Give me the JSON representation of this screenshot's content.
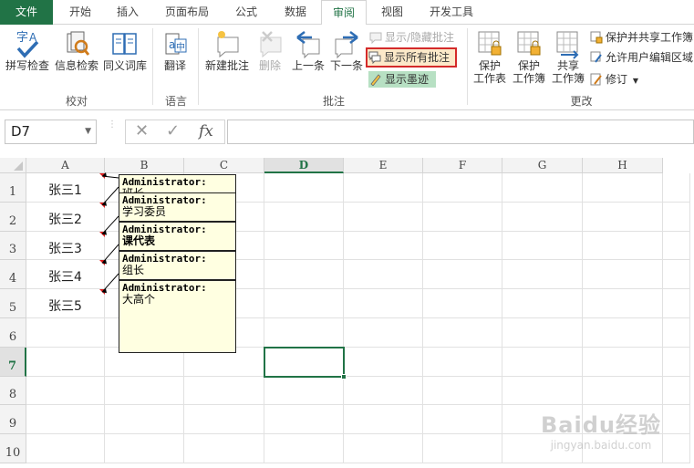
{
  "tabs": [
    "文件",
    "开始",
    "插入",
    "页面布局",
    "公式",
    "数据",
    "审阅",
    "视图",
    "开发工具"
  ],
  "active_tab": "审阅",
  "ribbon": {
    "proofing": {
      "spell": "拼写检查",
      "research": "信息检索",
      "thesaurus": "同义词库",
      "group": "校对"
    },
    "language": {
      "translate": "翻译",
      "group": "语言"
    },
    "comments": {
      "new": "新建批注",
      "delete": "删除",
      "prev": "上一条",
      "next": "下一条",
      "show_hide": "显示/隐藏批注",
      "show_all": "显示所有批注",
      "show_ink": "显示墨迹",
      "group": "批注"
    },
    "changes": {
      "protect_sheet": [
        "保护",
        "工作表"
      ],
      "protect_book": [
        "保护",
        "工作簿"
      ],
      "share_book": [
        "共享",
        "工作簿"
      ],
      "protect_share": "保护并共享工作簿",
      "allow_edit": "允许用户编辑区域",
      "track": "修订",
      "group": "更改"
    }
  },
  "namebox": "D7",
  "formula_icons": {
    "cancel": "✕",
    "enter": "✓",
    "fx": "fx"
  },
  "columns": [
    "A",
    "B",
    "C",
    "D",
    "E",
    "F",
    "G",
    "H"
  ],
  "selected_column": "D",
  "rows": [
    "1",
    "2",
    "3",
    "4",
    "5",
    "6",
    "7",
    "8",
    "9",
    "10"
  ],
  "selected_row": "7",
  "cells": [
    "张三1",
    "张三2",
    "张三3",
    "张三4",
    "张三5"
  ],
  "comments": [
    {
      "author": "Administrator:",
      "text": "班长"
    },
    {
      "author": "Administrator:",
      "text": "学习委员"
    },
    {
      "author": "Administrator:",
      "text": "课代表"
    },
    {
      "author": "Administrator:",
      "text": "组长"
    },
    {
      "author": "Administrator:",
      "text": "大高个"
    }
  ],
  "watermark": {
    "brand": "Baidu经验",
    "url": "jingyan.baidu.com"
  },
  "colors": {
    "accent": "#217346",
    "highlight_border": "#d42a2a",
    "comment_bg": "#ffffe1",
    "marker": "#e01e1e"
  }
}
